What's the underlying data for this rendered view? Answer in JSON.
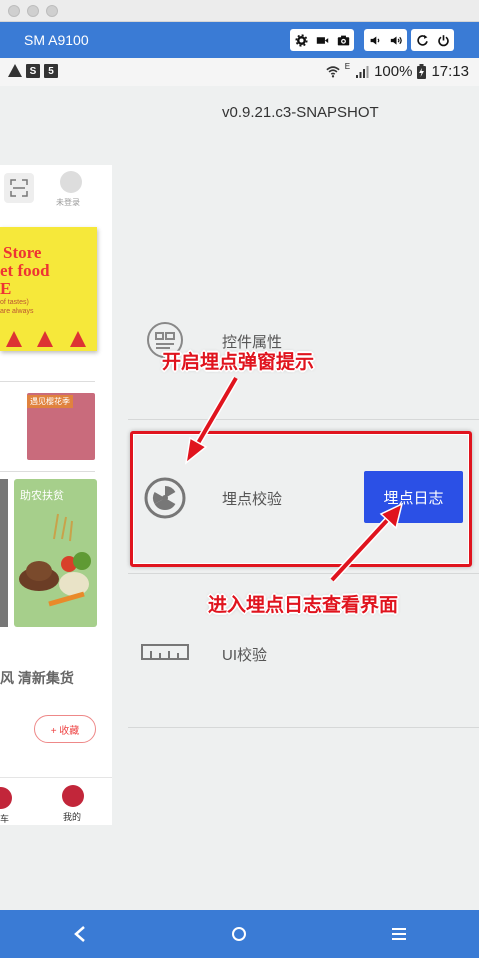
{
  "window": {
    "device_name": "SM A9100"
  },
  "status_bar": {
    "battery": "100%",
    "time": "17:13",
    "network": "E"
  },
  "version": "v0.9.21.c3-SNAPSHOT",
  "app_panel": {
    "login_text": "未登录",
    "promo_line1": "Store",
    "promo_line2": "et food",
    "promo_line3": "E",
    "promo_small1": "of tastes)",
    "promo_small2": "are always",
    "flower_tag": "遇见樱花季",
    "farm_title": "助农扶贫",
    "categories": "风  清新集货  ",
    "fav_button": "+ 收藏",
    "nav_left_label": "车",
    "nav_right_label": "我的"
  },
  "menu": {
    "item1_label": "控件属性",
    "item2_label": "埋点校验",
    "item3_label": "UI校验",
    "log_button": "埋点日志"
  },
  "annotations": {
    "top_text": "开启埋点弹窗提示",
    "bottom_text": "进入埋点日志查看界面",
    "color": "#e0141e"
  },
  "colors": {
    "toolbar": "#3a7bd5",
    "log_button": "#2b50e6"
  }
}
